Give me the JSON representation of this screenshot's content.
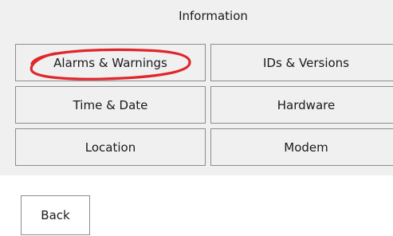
{
  "header": {
    "title": "Information"
  },
  "menu": {
    "items": [
      {
        "label": "Alarms & Warnings"
      },
      {
        "label": "IDs & Versions"
      },
      {
        "label": "Time & Date"
      },
      {
        "label": "Hardware"
      },
      {
        "label": "Location"
      },
      {
        "label": "Modem"
      }
    ]
  },
  "footer": {
    "back_label": "Back"
  },
  "annotation": {
    "shape": "hand-drawn ellipse",
    "target": "Alarms & Warnings",
    "color": "#e0262b"
  }
}
